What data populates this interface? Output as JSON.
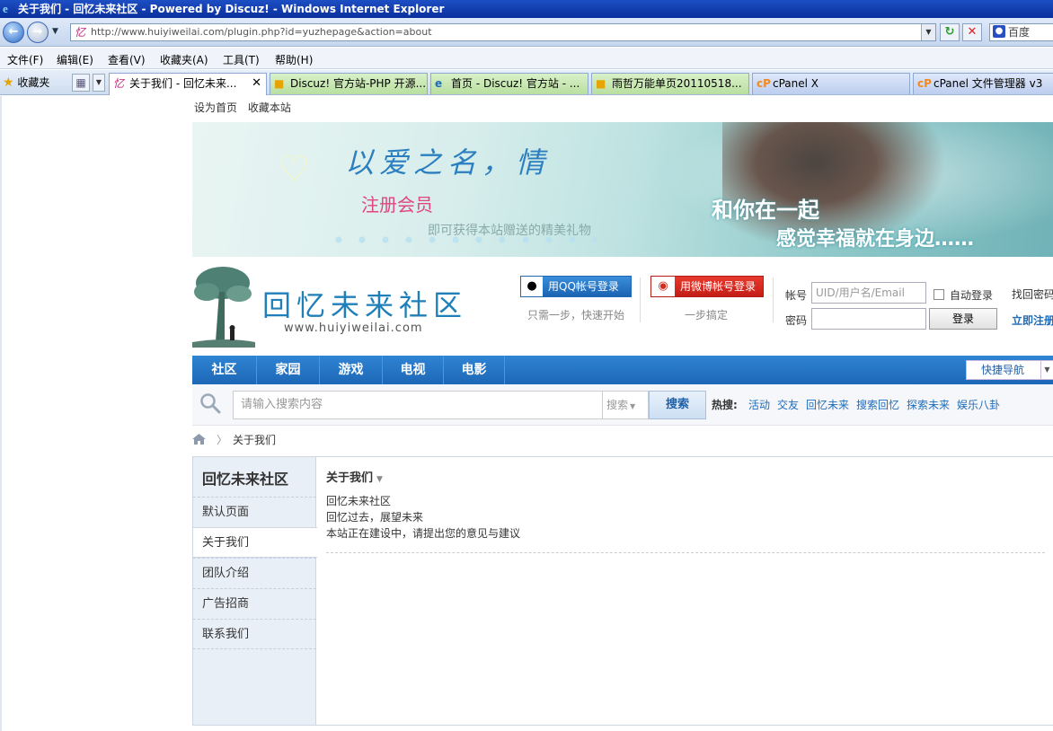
{
  "window": {
    "title": "关于我们 - 回忆未来社区 - Powered by Discuz! - Windows Internet Explorer"
  },
  "address_bar": {
    "url": "http://www.huiyiweilai.com/plugin.php?id=yuzhepage&action=about",
    "search_engine": "百度"
  },
  "menu": {
    "items": [
      "文件(F)",
      "编辑(E)",
      "查看(V)",
      "收藏夹(A)",
      "工具(T)",
      "帮助(H)"
    ]
  },
  "tabs_bar": {
    "favorites_label": "收藏夹",
    "tabs": [
      {
        "label": "关于我们 - 回忆未来...",
        "active": true
      },
      {
        "label": "Discuz! 官方站-PHP 开源..."
      },
      {
        "label": "首页 - Discuz! 官方站 - ..."
      },
      {
        "label": "雨哲万能单页20110518..."
      },
      {
        "label": "cPanel X"
      },
      {
        "label": "cPanel 文件管理器 v3"
      }
    ]
  },
  "toplinks": [
    "设为首页",
    "收藏本站"
  ],
  "banner": {
    "slogan": "以爱之名，情",
    "register": "注册会员",
    "gift": "即可获得本站赠送的精美礼物",
    "line1": "和你在一起",
    "line2": "感觉幸福就在身边……"
  },
  "site": {
    "name": "回忆未来社区",
    "url": "www.huiyiweilai.com"
  },
  "social_login": {
    "qq_label": "用QQ帐号登录",
    "qq_sub": "只需一步，快速开始",
    "weibo_label": "用微博帐号登录",
    "weibo_sub": "一步搞定"
  },
  "login": {
    "account_label": "帐号",
    "account_placeholder": "UID/用户名/Email",
    "auto_login": "自动登录",
    "forgot": "找回密码",
    "password_label": "密码",
    "login_button": "登录",
    "register_link": "立即注册"
  },
  "nav": {
    "items": [
      "社区",
      "家园",
      "游戏",
      "电视",
      "电影"
    ],
    "quicknav": "快捷导航"
  },
  "search": {
    "placeholder": "请输入搜索内容",
    "type": "搜索",
    "button": "搜索",
    "hot_label": "热搜:",
    "hot_items": [
      "活动",
      "交友",
      "回忆未来",
      "搜索回忆",
      "探索未来",
      "娱乐八卦"
    ]
  },
  "breadcrumb": {
    "current": "关于我们"
  },
  "sidebar": {
    "title": "回忆未来社区",
    "items": [
      "默认页面",
      "关于我们",
      "团队介绍",
      "广告招商",
      "联系我们"
    ]
  },
  "main": {
    "title": "关于我们",
    "lines": [
      "回忆未来社区",
      "回忆过去，展望未来",
      "本站正在建设中，请提出您的意见与建议"
    ]
  },
  "colors": {
    "nav_blue": "#2f84d3",
    "link_blue": "#1f6cb9",
    "register_pink": "#e0467f",
    "qq_blue": "#1a63b3",
    "weibo_red": "#c41d15"
  }
}
